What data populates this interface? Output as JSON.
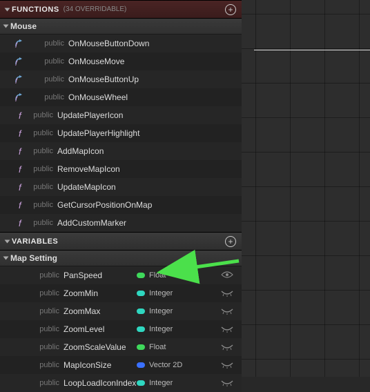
{
  "sections": {
    "functions": {
      "title": "FUNCTIONS",
      "count_label": "(34 OVERRIDABLE)"
    },
    "variables": {
      "title": "VARIABLES"
    }
  },
  "categories": {
    "mouse": "Mouse",
    "map_setting": "Map Setting"
  },
  "access": {
    "public": "public"
  },
  "functions_mouse": [
    {
      "name": "OnMouseButtonDown"
    },
    {
      "name": "OnMouseMove"
    },
    {
      "name": "OnMouseButtonUp"
    },
    {
      "name": "OnMouseWheel"
    }
  ],
  "functions_plain": [
    {
      "name": "UpdatePlayerIcon"
    },
    {
      "name": "UpdatePlayerHighlight"
    },
    {
      "name": "AddMapIcon"
    },
    {
      "name": "RemoveMapIcon"
    },
    {
      "name": "UpdateMapIcon"
    },
    {
      "name": "GetCursorPositionOnMap"
    },
    {
      "name": "AddCustomMarker"
    }
  ],
  "types": {
    "float": {
      "label": "Float",
      "color": "#3fd95b"
    },
    "integer": {
      "label": "Integer",
      "color": "#2fd7c0"
    },
    "vector2d": {
      "label": "Vector 2D",
      "color": "#3a70ff"
    }
  },
  "variables": [
    {
      "name": "PanSpeed",
      "type": "float",
      "eye": "open"
    },
    {
      "name": "ZoomMin",
      "type": "integer",
      "eye": "closed"
    },
    {
      "name": "ZoomMax",
      "type": "integer",
      "eye": "closed"
    },
    {
      "name": "ZoomLevel",
      "type": "integer",
      "eye": "closed"
    },
    {
      "name": "ZoomScaleValue",
      "type": "float",
      "eye": "closed"
    },
    {
      "name": "MapIconSize",
      "type": "vector2d",
      "eye": "closed"
    },
    {
      "name": "LoopLoadIconIndex",
      "type": "integer",
      "eye": "closed",
      "faded": true
    }
  ]
}
